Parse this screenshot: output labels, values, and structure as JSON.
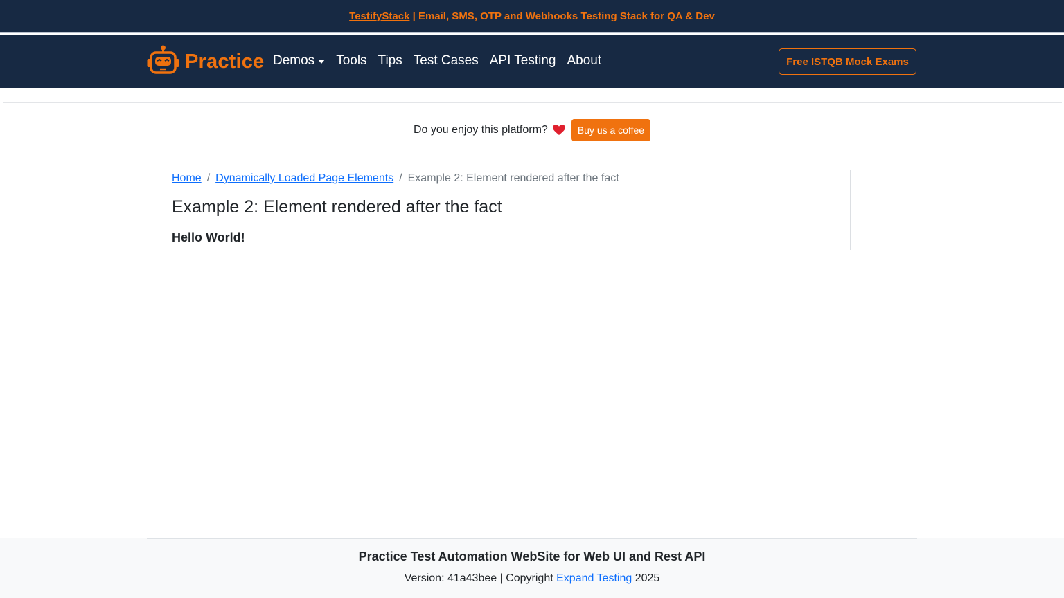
{
  "announcement": {
    "link_label": "TestifyStack",
    "text": " | Email, SMS, OTP and Webhooks Testing Stack for QA & Dev"
  },
  "navbar": {
    "brand": "Practice",
    "logo_icon": "robot-icon",
    "items": [
      {
        "label": "Demos",
        "has_dropdown": true
      },
      {
        "label": "Tools"
      },
      {
        "label": "Tips"
      },
      {
        "label": "Test Cases"
      },
      {
        "label": "API Testing"
      },
      {
        "label": "About"
      }
    ],
    "cta_label": "Free ISTQB Mock Exams"
  },
  "coffee": {
    "question": "Do you enjoy this platform?",
    "heart_icon": "heart-icon",
    "button_label": "Buy us a coffee"
  },
  "breadcrumb": {
    "items": [
      {
        "label": "Home"
      },
      {
        "label": "Dynamically Loaded Page Elements"
      },
      {
        "label": "Example 2: Element rendered after the fact"
      }
    ],
    "separator": "/"
  },
  "main": {
    "title": "Example 2: Element rendered after the fact",
    "message": "Hello World!"
  },
  "footer": {
    "title": "Practice Test Automation WebSite for Web UI and Rest API",
    "version_prefix": "Version: 41a43bee | Copyright ",
    "company_link": "Expand Testing",
    "year": " 2025"
  },
  "colors": {
    "navy": "#172943",
    "accent": "#f0720f",
    "link": "#0d6efd"
  }
}
